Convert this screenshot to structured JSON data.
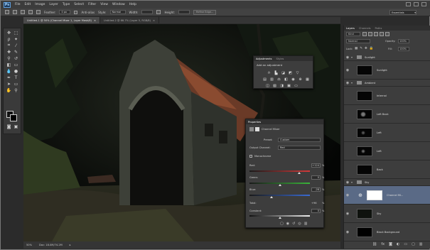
{
  "app": {
    "logo": "Ps"
  },
  "menu": [
    "File",
    "Edit",
    "Image",
    "Layer",
    "Type",
    "Select",
    "Filter",
    "View",
    "Window",
    "Help"
  ],
  "options": {
    "feather_label": "Feather:",
    "feather_value": "0 px",
    "antialias_label": "Anti-alias",
    "style_label": "Style:",
    "style_value": "Normal",
    "width_label": "Width:",
    "height_label": "Height:",
    "refine_label": "Refine Edge...",
    "workspace": "Essentials"
  },
  "doc_tabs": [
    {
      "label": "Untitled-1 @ 50% (Channel Mixer 1, Layer Mask/8)",
      "active": true
    },
    {
      "label": "Untitled-2 @ 66.7% (Layer 5, RGB/8)",
      "active": false
    }
  ],
  "status": {
    "zoom": "50%",
    "doc": "Doc: 18.0M/74.2M"
  },
  "adjustments": {
    "tabs": [
      "Adjustments",
      "Styles"
    ],
    "title": "Add an adjustment",
    "icon_rows": [
      [
        "brightness-icon",
        "levels-icon",
        "curves-icon",
        "exposure-icon"
      ],
      [
        "vibrance-icon",
        "hue-sat-icon",
        "color-balance-icon",
        "bw-icon",
        "photo-filter-icon",
        "channel-mixer-icon",
        "lookup-icon"
      ],
      [
        "invert-icon",
        "posterize-icon",
        "threshold-icon",
        "selective-color-icon",
        "gradient-map-icon"
      ]
    ]
  },
  "properties": {
    "tab": "Properties",
    "title": "Channel Mixer",
    "preset_label": "Preset:",
    "preset_value": "Custom",
    "output_label": "Output Channel:",
    "output_value": "Red",
    "mono_label": "Monochrome",
    "red_label": "Red:",
    "red_value": "+124",
    "red_level": 0.82,
    "green_label": "Green:",
    "green_value": "0",
    "green_level": 0.5,
    "blue_label": "Blue:",
    "blue_value": "-28",
    "blue_level": 0.36,
    "total_label": "Total:",
    "total_value": "+96",
    "constant_label": "Constant:",
    "constant_value": "0",
    "constant_level": 0.5,
    "pct": "%"
  },
  "layers": {
    "tabs": [
      "Layers",
      "Channels",
      "Paths"
    ],
    "kind_label": "Kind",
    "blend_mode": "Normal",
    "opacity_label": "Opacity:",
    "opacity_value": "100%",
    "lock_label": "Lock:",
    "fill_label": "Fill:",
    "fill_value": "100%",
    "items": [
      {
        "type": "group",
        "name": "Sunlight"
      },
      {
        "type": "layer",
        "name": "Sunlight"
      },
      {
        "type": "group",
        "name": "Ambient"
      },
      {
        "type": "layer",
        "name": "Internal"
      },
      {
        "type": "layer",
        "name": "Left Back"
      },
      {
        "type": "layer",
        "name": "Left"
      },
      {
        "type": "layer",
        "name": "Left"
      },
      {
        "type": "layer",
        "name": "Back"
      },
      {
        "type": "group",
        "name": "Sky"
      },
      {
        "type": "adjustment",
        "name": "Channel Mi..."
      },
      {
        "type": "layer",
        "name": "Sky"
      },
      {
        "type": "layer",
        "name": "Black Background"
      }
    ]
  }
}
